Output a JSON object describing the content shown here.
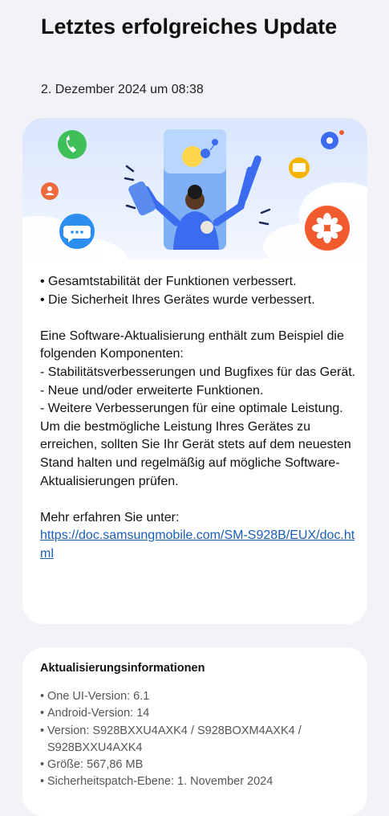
{
  "header": {
    "title": "Letztes erfolgreiches Update",
    "date": "2. Dezember 2024 um 08:38"
  },
  "hero": {
    "icons": [
      "phone-icon",
      "gear-icon",
      "person-icon",
      "chat-bubble-icon",
      "mail-icon",
      "flower-icon"
    ],
    "colors": {
      "phone": "#3fbf5a",
      "chat": "#2b8ef0",
      "mail": "#f4b400",
      "flower": "#f35b2f",
      "person": "#ef6a3a",
      "figure": "#3b6cf0"
    }
  },
  "notes": {
    "bullets": [
      "• Gesamtstabilität der Funktionen verbessert.",
      "• Die Sicherheit Ihres Gerätes wurde verbessert."
    ],
    "intro": "Eine Software-Aktualisierung enthält zum Beispiel die folgenden Komponenten:",
    "components": [
      " - Stabilitätsverbesserungen und Bugfixes für das Gerät.",
      " - Neue und/oder erweiterte Funktionen.",
      " - Weitere Verbesserungen für eine optimale Leistung."
    ],
    "advice": "Um die bestmögliche Leistung Ihres Gerätes zu erreichen, sollten Sie Ihr Gerät stets auf dem neuesten Stand halten und regelmäßig auf mögliche Software-Aktualisierungen prüfen.",
    "more_label": "Mehr erfahren Sie unter:",
    "more_link": "https://doc.samsungmobile.com/SM-S928B/EUX/doc.html"
  },
  "info": {
    "title": "Aktualisierungsinformationen",
    "items": [
      "One UI-Version: 6.1",
      "Android-Version: 14",
      "Version: S928BXXU4AXK4 / S928BOXM4AXK4 / S928BXXU4AXK4",
      "Größe: 567,86 MB",
      "Sicherheitspatch-Ebene: 1. November 2024"
    ]
  }
}
